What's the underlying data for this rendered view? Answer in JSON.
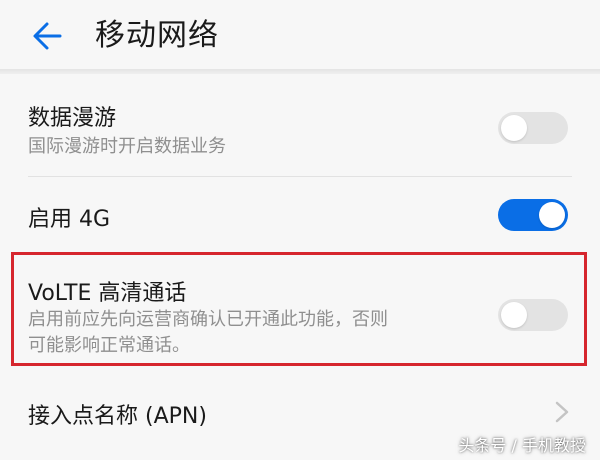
{
  "header": {
    "title": "移动网络",
    "back_icon": "arrow-left-icon",
    "accent_color": "#0a6ee6"
  },
  "settings": {
    "data_roaming": {
      "title": "数据漫游",
      "subtitle": "国际漫游时开启数据业务",
      "enabled": false
    },
    "enable_4g": {
      "title": "启用 4G",
      "enabled": true
    },
    "volte": {
      "title": "VoLTE 高清通话",
      "subtitle_line1": "启用前应先向运营商确认已开通此功能，否则",
      "subtitle_line2": "可能影响正常通话。",
      "enabled": false,
      "highlight_color": "#d6262e"
    },
    "apn": {
      "title": "接入点名称 (APN)",
      "icon": "chevron-right-icon"
    }
  },
  "watermark": "头条号 / 手机教授"
}
